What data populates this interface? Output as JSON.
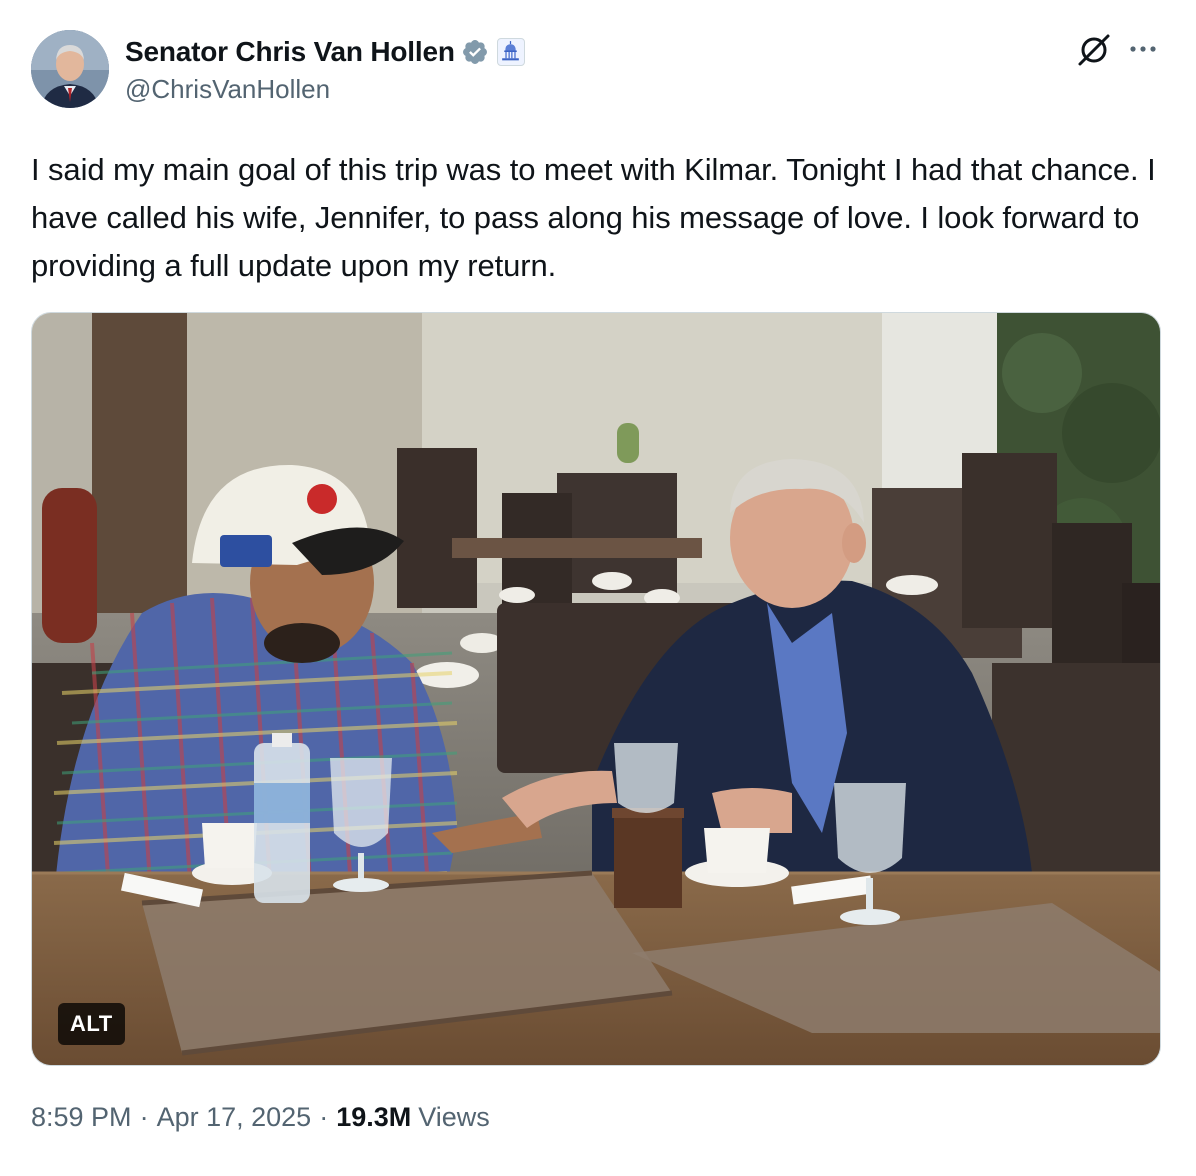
{
  "author": {
    "display_name": "Senator Chris Van Hollen",
    "handle": "@ChrisVanHollen",
    "verified_icon": "verified-badge-icon",
    "affiliation_icon": "capitol-building-icon"
  },
  "actions": {
    "grok_icon": "grok-icon",
    "more_icon": "more-options-icon"
  },
  "tweet": {
    "text": "I said my main goal of this trip was to meet with Kilmar. Tonight I had that chance. I have called his wife, Jennifer, to pass along his message of love. I look forward to providing a full update upon my return."
  },
  "media": {
    "alt_label": "ALT"
  },
  "meta": {
    "time": "8:59 PM",
    "separator": "·",
    "date": "Apr 17, 2025",
    "views_count": "19.3M",
    "views_label": "Views"
  },
  "colors": {
    "text_primary": "#0f1419",
    "text_secondary": "#536471",
    "border": "#cfd9de",
    "verified": "#829aab"
  }
}
